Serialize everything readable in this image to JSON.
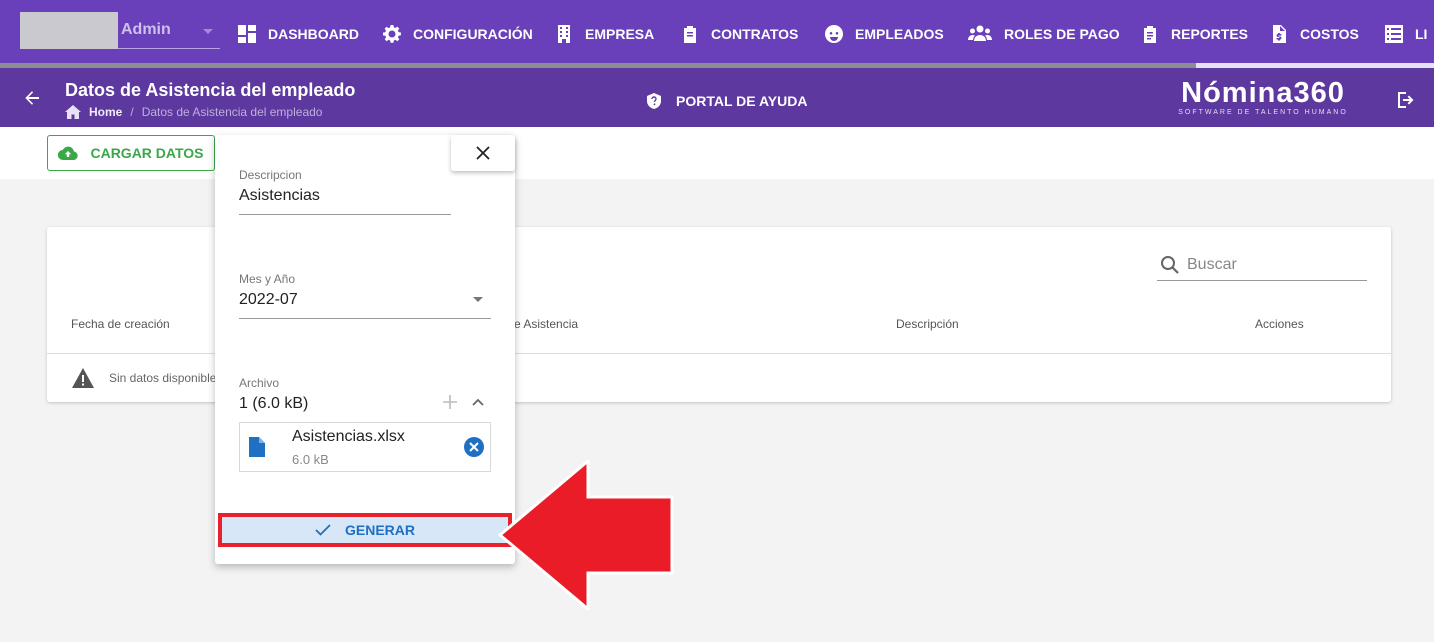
{
  "user": {
    "name": "Admin"
  },
  "nav": [
    {
      "label": "DASHBOARD",
      "icon": "dashboard-icon"
    },
    {
      "label": "CONFIGURACIÓN",
      "icon": "gear-icon"
    },
    {
      "label": "EMPRESA",
      "icon": "building-icon"
    },
    {
      "label": "CONTRATOS",
      "icon": "clipboard-icon"
    },
    {
      "label": "EMPLEADOS",
      "icon": "face-icon"
    },
    {
      "label": "ROLES DE PAGO",
      "icon": "users-icon"
    },
    {
      "label": "REPORTES",
      "icon": "report-icon"
    },
    {
      "label": "COSTOS",
      "icon": "file-dollar-icon"
    },
    {
      "label": "LI",
      "icon": "list-icon"
    }
  ],
  "header": {
    "title": "Datos de Asistencia del empleado",
    "breadcrumb_home": "Home",
    "breadcrumb_current": "Datos de Asistencia del empleado",
    "help_label": "PORTAL DE AYUDA",
    "brand_name": "Nómina360",
    "brand_tagline": "SOFTWARE DE TALENTO HUMANO"
  },
  "toolbar": {
    "upload_label": "CARGAR DATOS"
  },
  "table": {
    "search_placeholder": "Buscar",
    "columns": [
      "Fecha de creación",
      "e Asistencia",
      "Descripción",
      "Acciones"
    ],
    "empty_text": "Sin datos disponible"
  },
  "form": {
    "description_label": "Descripcion",
    "description_value": "Asistencias",
    "month_label": "Mes y Año",
    "month_value": "2022-07",
    "file_label": "Archivo",
    "file_count": "1 (6.0 kB)",
    "file_name": "Asistencias.xlsx",
    "file_size": "6.0 kB",
    "generate_label": "GENERAR"
  },
  "colors": {
    "primary": "#6a3fba",
    "subheader": "#5d389f",
    "success": "#3aa847",
    "accent": "#1f6fc2",
    "highlight": "#e8212c"
  }
}
